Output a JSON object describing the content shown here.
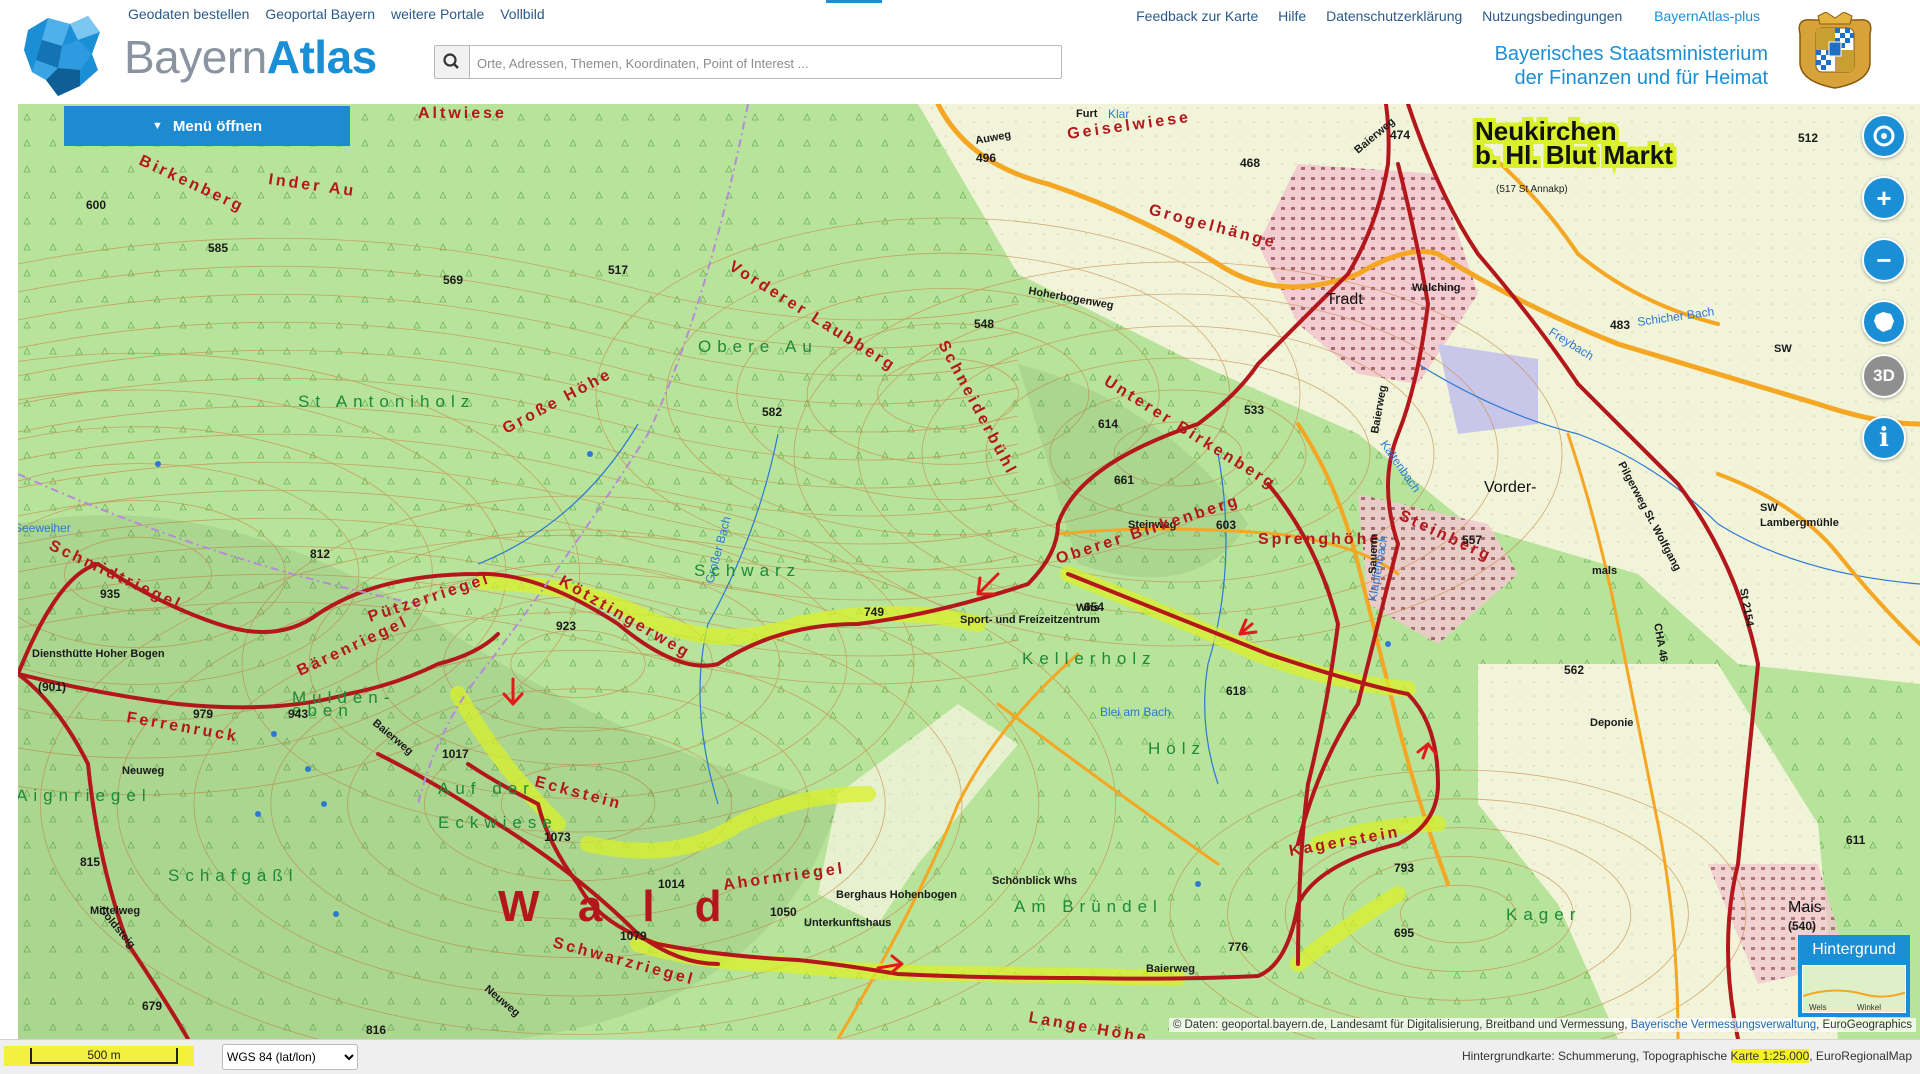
{
  "header": {
    "top_links": [
      "Geodaten bestellen",
      "Geoportal Bayern",
      "weitere Portale",
      "Vollbild"
    ],
    "logo_part1": "Bayern",
    "logo_part2": "Atlas",
    "search_placeholder": "Orte, Adressen, Themen, Koordinaten, Point of Interest ...",
    "right_links": [
      "Feedback zur Karte",
      "Hilfe",
      "Datenschutzerklärung",
      "Nutzungsbedingungen"
    ],
    "plus_link": "BayernAtlas-plus",
    "ministry_line1": "Bayerisches Staatsministerium",
    "ministry_line2": "der Finanzen und für Heimat"
  },
  "menu": {
    "label": "Menü öffnen"
  },
  "controls": {
    "locate_icon": "crosshair-locate-icon",
    "zoom_in_icon": "plus-icon",
    "zoom_out_icon": "minus-icon",
    "bavaria_icon": "bavaria-shape-icon",
    "three_d_label": "3D",
    "info_icon": "info-icon"
  },
  "background_panel": {
    "label": "Hintergrund",
    "thumb_label_1": "Wels",
    "thumb_label_2": "Winkel"
  },
  "attribution": {
    "prefix": "© Daten: ",
    "text1": "geoportal.bayern.de",
    "text2": ", Landesamt für Digitalisierung, Breitband und Vermessung, ",
    "link": "Bayerische Vermessungsverwaltung",
    "text3": ", EuroGeographics"
  },
  "footer": {
    "scale_label": "500 m",
    "crs_selected": "WGS 84 (lat/lon)",
    "bgmap_prefix": "Hintergrundkarte: Schummerung, Topographische ",
    "bgmap_hl": "Karte 1:25.000",
    "bgmap_suffix": ", EuroRegionalMap"
  },
  "map": {
    "colors": {
      "forest": "#b7e39a",
      "meadow": "#f1f4d8",
      "settlement": "#f2c8cf",
      "route_red": "#b3171c",
      "road_orange": "#f5a623",
      "highlight": "#d9f02a",
      "contour": "#c8894a",
      "water": "#2b78d6"
    },
    "labels": [
      {
        "text": "Altwiese",
        "style": "name"
      },
      {
        "text": "Birkenberg",
        "style": "name"
      },
      {
        "text": "Inder Au",
        "style": "name"
      },
      {
        "text": "600",
        "style": "height"
      },
      {
        "text": "585",
        "style": "height"
      },
      {
        "text": "569",
        "style": "height"
      },
      {
        "text": "517",
        "style": "height"
      },
      {
        "text": "496",
        "style": "height"
      },
      {
        "text": "Auweg",
        "style": "road"
      },
      {
        "text": "Geiselwiese",
        "style": "name"
      },
      {
        "text": "Furt",
        "style": "road"
      },
      {
        "text": "Klar",
        "style": "water"
      },
      {
        "text": "468",
        "style": "height"
      },
      {
        "text": "Baierweg",
        "style": "road"
      },
      {
        "text": "474",
        "style": "height"
      },
      {
        "text": "Neukirchen",
        "style": "town"
      },
      {
        "text": "b. Hl. Blut Markt",
        "style": "town"
      },
      {
        "text": "(517 St Annakp)",
        "style": "small"
      },
      {
        "text": "512",
        "style": "height"
      },
      {
        "text": "Grogelhänge",
        "style": "name"
      },
      {
        "text": "Vorderer Laubberg",
        "style": "name"
      },
      {
        "text": "Obere Au",
        "style": "nameg"
      },
      {
        "text": "548",
        "style": "height"
      },
      {
        "text": "Hoherbogenweg",
        "style": "road"
      },
      {
        "text": "Tradt",
        "style": "village"
      },
      {
        "text": "Walching",
        "style": "road"
      },
      {
        "text": "Freybach",
        "style": "water"
      },
      {
        "text": "483",
        "style": "height"
      },
      {
        "text": "Schicher Bach",
        "style": "water"
      },
      {
        "text": "SW",
        "style": "road"
      },
      {
        "text": "St Antoniholz",
        "style": "nameg"
      },
      {
        "text": "Schneiderbühl",
        "style": "name"
      },
      {
        "text": "582",
        "style": "height"
      },
      {
        "text": "Große Höhe",
        "style": "name"
      },
      {
        "text": "614",
        "style": "height"
      },
      {
        "text": "Unterer Birkenberg",
        "style": "name"
      },
      {
        "text": "533",
        "style": "height"
      },
      {
        "text": "Baierweg",
        "style": "road"
      },
      {
        "text": "Kaltenbach",
        "style": "water"
      },
      {
        "text": "Pilgerweg St. Wolfgang",
        "style": "road"
      },
      {
        "text": "Vorder-",
        "style": "village"
      },
      {
        "text": "661",
        "style": "height"
      },
      {
        "text": "Steinweg",
        "style": "road"
      },
      {
        "text": "603",
        "style": "height"
      },
      {
        "text": "Sprenghöhe",
        "style": "name"
      },
      {
        "text": "Steinberg",
        "style": "name"
      },
      {
        "text": "557",
        "style": "height"
      },
      {
        "text": "SW",
        "style": "road"
      },
      {
        "text": "Lambergmühle",
        "style": "road"
      },
      {
        "text": "Seewelher",
        "style": "water"
      },
      {
        "text": "Schmidtriegel",
        "style": "name"
      },
      {
        "text": "935",
        "style": "height"
      },
      {
        "text": "812",
        "style": "height"
      },
      {
        "text": "Großer Bach",
        "style": "water"
      },
      {
        "text": "Schwarz",
        "style": "nameg"
      },
      {
        "text": "Oberer Birkenberg",
        "style": "name"
      },
      {
        "text": "Whs",
        "style": "road"
      },
      {
        "text": "654",
        "style": "height"
      },
      {
        "text": "Sauerm",
        "style": "road"
      },
      {
        "text": "Klapfenbach",
        "style": "water"
      },
      {
        "text": "mals",
        "style": "road"
      },
      {
        "text": "St 2154",
        "style": "road"
      },
      {
        "text": "Pützerriegel",
        "style": "name"
      },
      {
        "text": "Kötztingerweg",
        "style": "name"
      },
      {
        "text": "749",
        "style": "height"
      },
      {
        "text": "923",
        "style": "height"
      },
      {
        "text": "Sport- und Freizeitzentrum",
        "style": "road"
      },
      {
        "text": "Kellerholz",
        "style": "nameg"
      },
      {
        "text": "CHA 46",
        "style": "road"
      },
      {
        "text": "562",
        "style": "height"
      },
      {
        "text": "Diensthütte Hoher Bogen",
        "style": "road"
      },
      {
        "text": "(901)",
        "style": "height"
      },
      {
        "text": "Bärenriegel",
        "style": "name"
      },
      {
        "text": "Mulden-",
        "style": "nameg"
      },
      {
        "text": "eben",
        "style": "nameg"
      },
      {
        "text": "979",
        "style": "height"
      },
      {
        "text": "943",
        "style": "height"
      },
      {
        "text": "Ferrenruck",
        "style": "name"
      },
      {
        "text": "1017",
        "style": "height"
      },
      {
        "text": "Baierweg",
        "style": "road"
      },
      {
        "text": "Blei am Bach",
        "style": "water"
      },
      {
        "text": "618",
        "style": "height"
      },
      {
        "text": "Deponie",
        "style": "road"
      },
      {
        "text": "Holz",
        "style": "nameg"
      },
      {
        "text": "Neuweg",
        "style": "road"
      },
      {
        "text": "Aignriegel",
        "style": "nameg"
      },
      {
        "text": "Auf der",
        "style": "nameg"
      },
      {
        "text": "Eckwiese",
        "style": "nameg"
      },
      {
        "text": "Eckstein",
        "style": "name"
      },
      {
        "text": "1073",
        "style": "height"
      },
      {
        "text": "815",
        "style": "height"
      },
      {
        "text": "Schafgaßl",
        "style": "nameg"
      },
      {
        "text": "1014",
        "style": "height"
      },
      {
        "text": "Mittelweg",
        "style": "road"
      },
      {
        "text": "Kagerstein",
        "style": "name"
      },
      {
        "text": "793",
        "style": "height"
      },
      {
        "text": "Schönblick Whs",
        "style": "road"
      },
      {
        "text": "Am Bründel",
        "style": "nameg"
      },
      {
        "text": "Ahornriegel",
        "style": "name"
      },
      {
        "text": "1050",
        "style": "height"
      },
      {
        "text": "Berghaus Hohenbogen",
        "style": "road"
      },
      {
        "text": "Unterkunftshaus",
        "style": "road"
      },
      {
        "text": "1079",
        "style": "height"
      },
      {
        "text": "Schwarzriegel",
        "style": "name"
      },
      {
        "text": "Goldsteig",
        "style": "road"
      },
      {
        "text": "695",
        "style": "height"
      },
      {
        "text": "Kager",
        "style": "nameg"
      },
      {
        "text": "Mais",
        "style": "village"
      },
      {
        "text": "(540)",
        "style": "height"
      },
      {
        "text": "611",
        "style": "height"
      },
      {
        "text": "776",
        "style": "height"
      },
      {
        "text": "Baierweg",
        "style": "road"
      },
      {
        "text": "Lange Höhe",
        "style": "name"
      },
      {
        "text": "679",
        "style": "height"
      },
      {
        "text": "816",
        "style": "height"
      },
      {
        "text": "Neuweg",
        "style": "road"
      },
      {
        "text": "Wald",
        "style": "big"
      }
    ]
  }
}
